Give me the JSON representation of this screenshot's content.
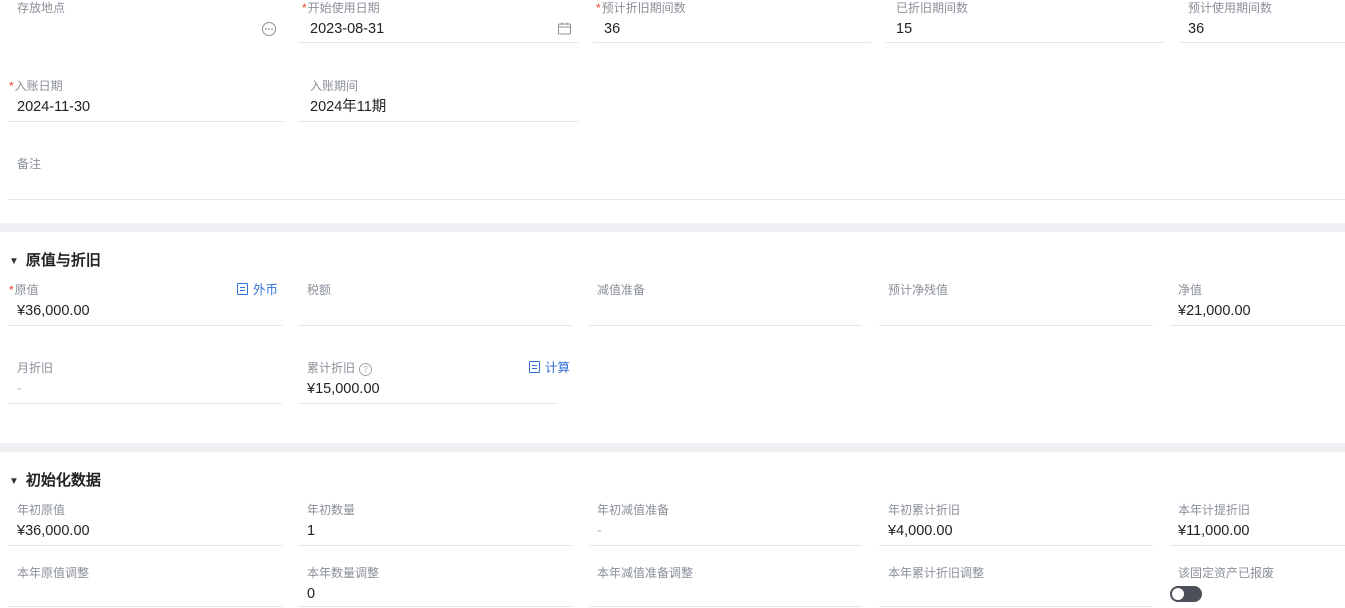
{
  "basic": {
    "location": {
      "label": "存放地点",
      "value": ""
    },
    "start_date": {
      "required_mark": "*",
      "label": "开始使用日期",
      "value": "2023-08-31"
    },
    "est_depr_periods": {
      "required_mark": "*",
      "label": "预计折旧期间数",
      "value": "36"
    },
    "depr_periods_done": {
      "label": "已折旧期间数",
      "value": "15"
    },
    "est_use_periods": {
      "label": "预计使用期间数",
      "value": "36"
    },
    "entry_date": {
      "required_mark": "*",
      "label": "入账日期",
      "value": "2024-11-30"
    },
    "entry_period": {
      "label": "入账期间",
      "value": "2024年11期"
    },
    "remark": {
      "label": "备注",
      "value": ""
    }
  },
  "depreciation": {
    "title": "原值与折旧",
    "original_value": {
      "required_mark": "*",
      "label": "原值",
      "value": "¥36,000.00",
      "link": "外币"
    },
    "tax": {
      "label": "税额",
      "value": ""
    },
    "impairment": {
      "label": "减值准备",
      "value": ""
    },
    "est_residual": {
      "label": "预计净残值",
      "value": ""
    },
    "net_value": {
      "label": "净值",
      "value": "¥21,000.00"
    },
    "monthly_depr": {
      "label": "月折旧",
      "value": "-"
    },
    "accum_depr": {
      "label": "累计折旧",
      "help": "?",
      "value": "¥15,000.00",
      "link": "计算"
    }
  },
  "init": {
    "title": "初始化数据",
    "year_begin_value": {
      "label": "年初原值",
      "value": "¥36,000.00"
    },
    "year_begin_qty": {
      "label": "年初数量",
      "value": "1"
    },
    "year_begin_impair": {
      "label": "年初减值准备",
      "value": "-"
    },
    "year_begin_accum": {
      "label": "年初累计折旧",
      "value": "¥4,000.00"
    },
    "year_depr": {
      "label": "本年计提折旧",
      "value": "¥11,000.00"
    },
    "value_adjust": {
      "label": "本年原值调整",
      "value": ""
    },
    "qty_adjust": {
      "label": "本年数量调整",
      "value": "0"
    },
    "impair_adjust": {
      "label": "本年减值准备调整",
      "value": ""
    },
    "accum_adjust": {
      "label": "本年累计折旧调整",
      "value": ""
    },
    "scrapped": {
      "label": "该固定资产已报废",
      "on": false
    }
  },
  "colors": {
    "required": "#f04134",
    "link": "#3370d8",
    "band": "#eef0f4",
    "toggle_off": "#4a4f58"
  },
  "icons": {
    "more": "ellipsis-circle-icon",
    "calendar": "calendar-icon",
    "doc": "document-icon",
    "help": "question-circle-icon",
    "collapse": "caret-down-icon"
  }
}
